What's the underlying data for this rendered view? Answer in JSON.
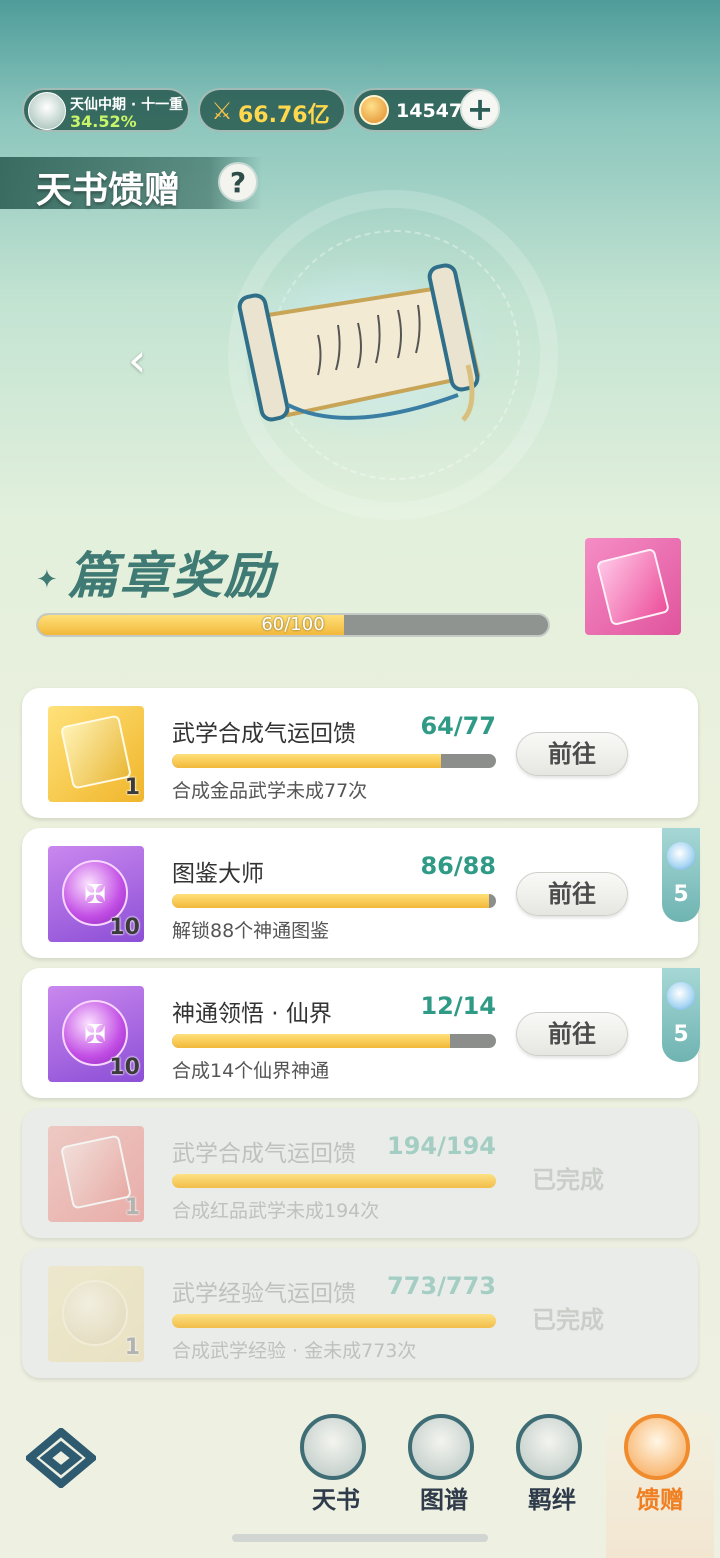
{
  "status": {
    "rank_title": "天仙中期 · 十一重",
    "rank_progress": "34.52%",
    "power": "66.76亿",
    "coins": "14547",
    "icons": {
      "avatar": "cultivator-avatar",
      "power": "crossed-swords-icon",
      "coin": "copper-coin-icon",
      "add": "plus-icon"
    }
  },
  "header": {
    "title": "天书馈赠",
    "help_icon": "question-icon"
  },
  "showcase": {
    "prev_icon": "chevron-left-icon",
    "item": "heavenly-scroll"
  },
  "chapter": {
    "title": "篇章奖励",
    "progress_label": "60/100",
    "progress": {
      "current": 60,
      "total": 100
    },
    "reward_icon": "pink-manual-book"
  },
  "tasks": [
    {
      "name": "武学合成气运回馈",
      "count": "64/77",
      "progress": 0.83,
      "desc": "合成金品武学未成77次",
      "reward_icon": "gold-manual-book",
      "reward_qty": "1",
      "action": "前往",
      "side_reward": null,
      "completed": false
    },
    {
      "name": "图鉴大师",
      "count": "86/88",
      "progress": 0.977,
      "desc": "解锁88个神通图鉴",
      "reward_icon": "purple-orb",
      "reward_qty": "10",
      "action": "前往",
      "side_reward": "5",
      "completed": false
    },
    {
      "name": "神通领悟 · 仙界",
      "count": "12/14",
      "progress": 0.857,
      "desc": "合成14个仙界神通",
      "reward_icon": "purple-orb",
      "reward_qty": "10",
      "action": "前往",
      "side_reward": "5",
      "completed": false
    },
    {
      "name": "武学合成气运回馈",
      "count": "194/194",
      "progress": 1.0,
      "desc": "合成红品武学未成194次",
      "reward_icon": "red-manual-book",
      "reward_qty": "1",
      "action": "已完成",
      "side_reward": null,
      "completed": true
    },
    {
      "name": "武学经验气运回馈",
      "count": "773/773",
      "progress": 1.0,
      "desc": "合成武学经验 · 金未成773次",
      "reward_icon": "meditating-figure-orb",
      "reward_qty": "1",
      "action": "已完成",
      "side_reward": null,
      "completed": true
    }
  ],
  "nav": {
    "logo_icon": "diamond-knot-logo",
    "tabs": [
      {
        "label": "天书",
        "icon": "book-icon"
      },
      {
        "label": "图谱",
        "icon": "map-scroll-icon"
      },
      {
        "label": "羁绊",
        "icon": "handshake-icon"
      },
      {
        "label": "馈赠",
        "icon": "gift-bag-icon",
        "active": true
      }
    ]
  }
}
